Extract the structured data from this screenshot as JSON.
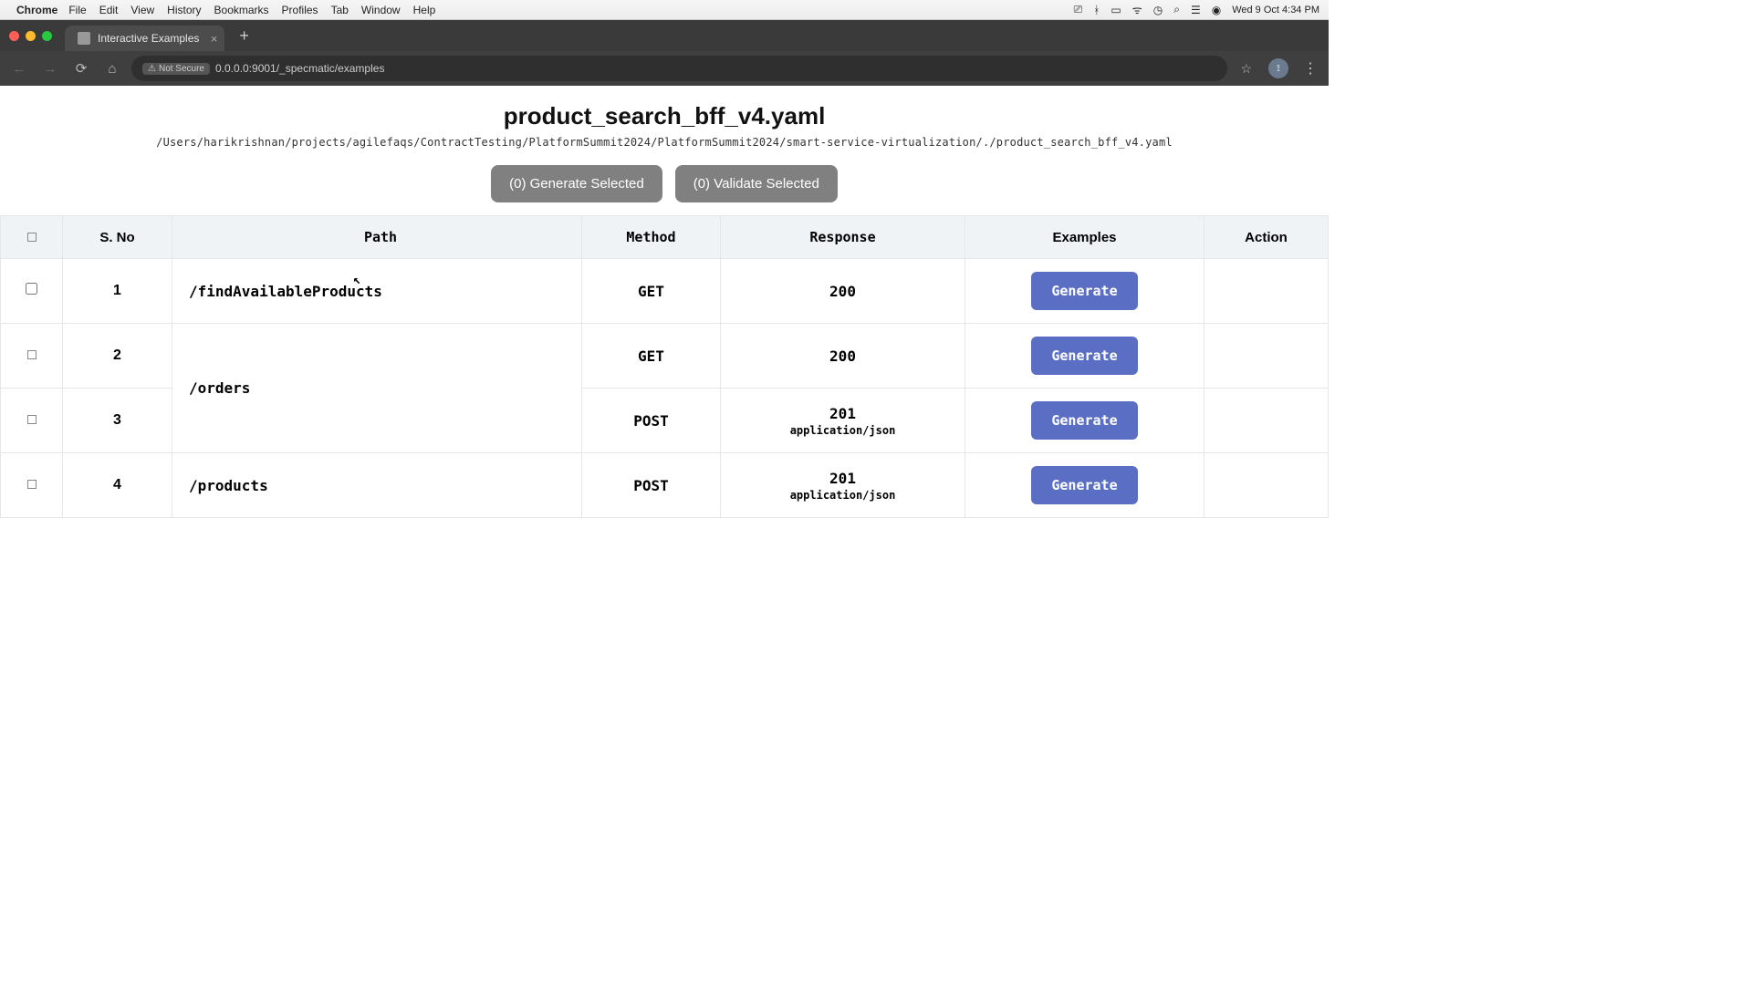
{
  "menubar": {
    "app": "Chrome",
    "items": [
      "File",
      "Edit",
      "View",
      "History",
      "Bookmarks",
      "Profiles",
      "Tab",
      "Window",
      "Help"
    ],
    "clock": "Wed 9 Oct 4:34 PM"
  },
  "tab": {
    "title": "Interactive Examples"
  },
  "urlbar": {
    "secure_label": "Not Secure",
    "url": "0.0.0.0:9001/_specmatic/examples"
  },
  "page": {
    "title": "product_search_bff_v4.yaml",
    "subtitle": "/Users/harikrishnan/projects/agilefaqs/ContractTesting/PlatformSummit2024/PlatformSummit2024/smart-service-virtualization/./product_search_bff_v4.yaml",
    "btn_generate": "(0) Generate Selected",
    "btn_validate": "(0) Validate Selected"
  },
  "headers": {
    "sno": "S. No",
    "path": "Path",
    "method": "Method",
    "response": "Response",
    "examples": "Examples",
    "action": "Action"
  },
  "rows": [
    {
      "sno": "1",
      "path": "/findAvailableProducts",
      "method": "GET",
      "response": "200",
      "response_sub": "",
      "btn": "Generate"
    },
    {
      "sno": "2",
      "path": "",
      "method": "GET",
      "response": "200",
      "response_sub": "",
      "btn": "Generate"
    },
    {
      "sno": "3",
      "path": "/orders",
      "method": "POST",
      "response": "201",
      "response_sub": "application/json",
      "btn": "Generate"
    },
    {
      "sno": "4",
      "path": "/products",
      "method": "POST",
      "response": "201",
      "response_sub": "application/json",
      "btn": "Generate"
    }
  ],
  "group_path_23": "/orders"
}
